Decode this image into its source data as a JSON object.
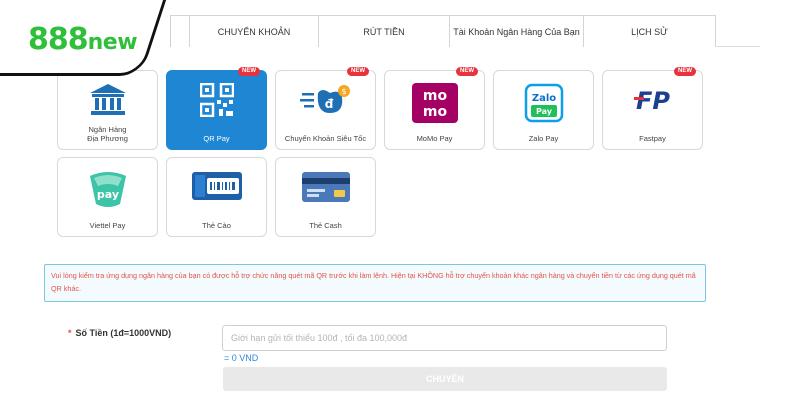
{
  "brand": {
    "logo_number": "888",
    "logo_word": "new"
  },
  "tabs": [
    {
      "label": ""
    },
    {
      "label": "CHUYỂN KHOẢN"
    },
    {
      "label": "RÚT TIỀN"
    },
    {
      "label": "Tài Khoản Ngân Hàng Của Bạn"
    },
    {
      "label": "LỊCH SỬ"
    }
  ],
  "methods": [
    {
      "label": "Ngân Hàng\nĐịa Phương",
      "icon": "bank-icon",
      "new": false,
      "selected": false
    },
    {
      "label": "QR Pay",
      "icon": "qr-icon",
      "new": true,
      "selected": true
    },
    {
      "label": "Chuyển Khoản Siêu Tốc",
      "icon": "fast-transfer-icon",
      "new": true,
      "selected": false
    },
    {
      "label": "MoMo Pay",
      "icon": "momo-icon",
      "new": true,
      "selected": false
    },
    {
      "label": "Zalo Pay",
      "icon": "zalo-icon",
      "new": false,
      "selected": false
    },
    {
      "label": "Fastpay",
      "icon": "fastpay-icon",
      "new": true,
      "selected": false
    },
    {
      "label": "Viettel Pay",
      "icon": "viettel-icon",
      "new": false,
      "selected": false
    },
    {
      "label": "Thẻ Cào",
      "icon": "scratch-card-icon",
      "new": false,
      "selected": false
    },
    {
      "label": "Thẻ Cash",
      "icon": "cash-card-icon",
      "new": false,
      "selected": false
    }
  ],
  "new_badge": "NEW",
  "momo_text": {
    "line1": "mo",
    "line2": "mo"
  },
  "zalo_text": {
    "line1": "Zalo",
    "line2": "Pay"
  },
  "fastpay_text": "FP",
  "viettel_text": "pay",
  "notice": "Vui lòng kiểm tra ứng dụng ngân hàng của bạn có được hỗ trợ chức năng quét mã QR trước khi làm lệnh. Hiện tại KHÔNG hỗ trợ chuyển khoản khác ngân hàng và chuyển tiền từ các ứng dụng quét mã QR khác.",
  "form": {
    "required_mark": "*",
    "amount_label": "Số Tiền (1đ=1000VND)",
    "amount_placeholder": "Giới hạn gửi tối thiểu 100đ , tối đa 100,000đ",
    "amount_value": "",
    "converted": "= 0 VND",
    "submit_label": "CHUYỂN"
  },
  "colors": {
    "accent": "#1f86d3",
    "brand_green": "#2fbf3a",
    "badge_red": "#e8323c",
    "notice_text": "#e2534a"
  }
}
